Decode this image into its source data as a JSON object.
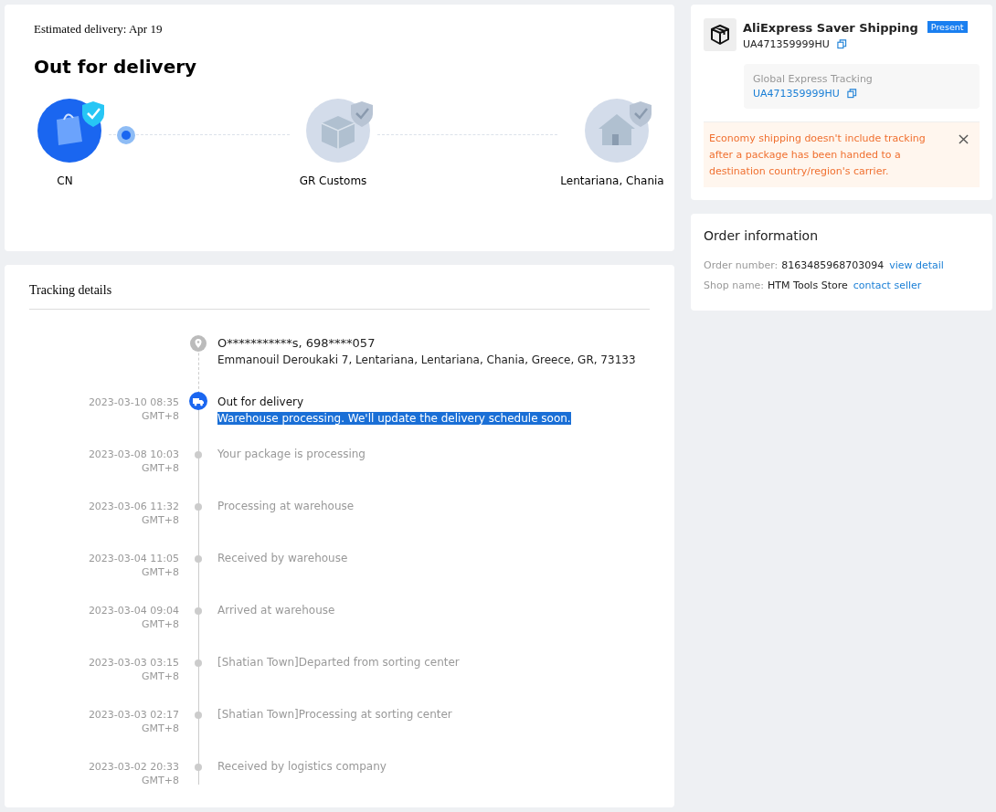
{
  "delivery": {
    "estimate": "Estimated delivery: Apr 19",
    "status": "Out for delivery",
    "stages": [
      {
        "label": "CN",
        "kind": "bag",
        "reached": true
      },
      {
        "label": "GR Customs",
        "kind": "box",
        "reached": false
      },
      {
        "label": "Lentariana, Chania",
        "kind": "house",
        "reached": false
      }
    ]
  },
  "tracking": {
    "title": "Tracking details",
    "address": {
      "name": "O***********s,  698****057",
      "line": "Emmanouil Deroukaki 7, Lentariana,  Lentariana, Chania,  Greece,  GR,  73133"
    },
    "events": [
      {
        "date": "2023-03-10 08:35",
        "zone": "GMT+8",
        "title": "Out for delivery",
        "detail": "Warehouse processing. We'll update the delivery schedule soon.",
        "current": true,
        "highlighted": true
      },
      {
        "date": "2023-03-08 10:03",
        "zone": "GMT+8",
        "title": "Your package is processing",
        "current": false
      },
      {
        "date": "2023-03-06 11:32",
        "zone": "GMT+8",
        "title": "Processing at warehouse",
        "current": false
      },
      {
        "date": "2023-03-04 11:05",
        "zone": "GMT+8",
        "title": "Received by warehouse",
        "current": false
      },
      {
        "date": "2023-03-04 09:04",
        "zone": "GMT+8",
        "title": "Arrived at warehouse",
        "current": false
      },
      {
        "date": "2023-03-03 03:15",
        "zone": "GMT+8",
        "title": "[Shatian Town]Departed from sorting center",
        "current": false
      },
      {
        "date": "2023-03-03 02:17",
        "zone": "GMT+8",
        "title": "[Shatian Town]Processing at sorting center",
        "current": false
      },
      {
        "date": "2023-03-02 20:33",
        "zone": "GMT+8",
        "title": "Received by logistics company",
        "current": false
      }
    ]
  },
  "shipping": {
    "carrier": "AliExpress Saver Shipping",
    "badge": "Present",
    "number": "UA471359999HU",
    "global": {
      "label": "Global Express Tracking",
      "number": "UA471359999HU"
    },
    "notice": "Economy shipping doesn't include tracking after a package has been handed to a destination country/region's carrier."
  },
  "order": {
    "title": "Order information",
    "rows": [
      {
        "label": "Order number:",
        "value": "8163485968703094",
        "link": "view detail"
      },
      {
        "label": "Shop name:",
        "value": "HTM Tools Store",
        "link": "contact seller"
      }
    ]
  }
}
